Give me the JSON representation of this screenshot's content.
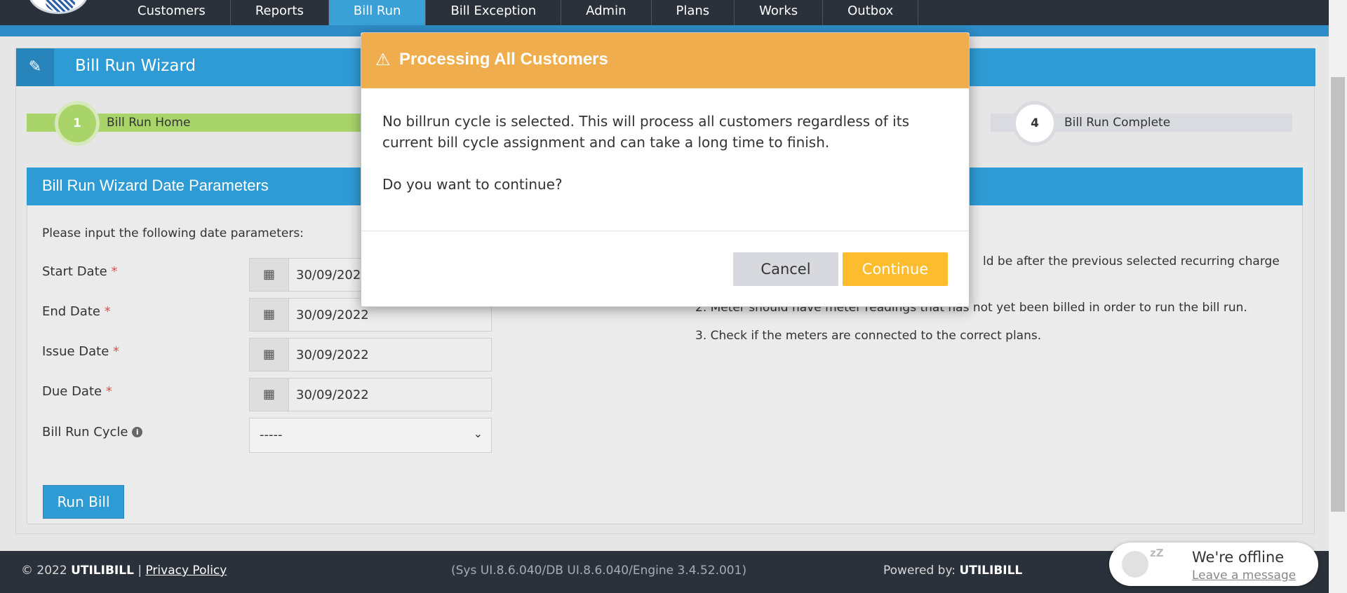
{
  "nav": {
    "tabs": [
      "Customers",
      "Reports",
      "Bill Run",
      "Bill Exception",
      "Admin",
      "Plans",
      "Works",
      "Outbox"
    ],
    "active": "Bill Run"
  },
  "panel": {
    "title": "Bill Run Wizard"
  },
  "steps": [
    {
      "number": "1",
      "label": "Bill Run Home"
    },
    {
      "number": "4",
      "label": "Bill Run Complete"
    }
  ],
  "params": {
    "header": "Bill Run Wizard Date Parameters",
    "intro": "Please input the following date parameters:",
    "required_mark": "*",
    "start_date": {
      "label": "Start Date",
      "value": "30/09/2022"
    },
    "end_date": {
      "label": "End Date",
      "value": "30/09/2022"
    },
    "issue_date": {
      "label": "Issue Date",
      "value": "30/09/2022"
    },
    "due_date": {
      "label": "Due Date",
      "value": "30/09/2022"
    },
    "cycle": {
      "label": "Bill Run Cycle",
      "value": "-----"
    },
    "run_button": "Run Bill"
  },
  "notes": {
    "note1_fragment": "ld be after the previous selected recurring charge",
    "note2": "2. Meter should have meter readings that has not yet been billed in order to run the bill run.",
    "note3": "3. Check if the meters are connected to the correct plans."
  },
  "modal": {
    "title": "Processing All Customers",
    "message_line1": "No billrun cycle is selected. This will process all customers regardless of its",
    "message_line2": "current bill cycle assignment and can take a long time to finish.",
    "question": "Do you want to continue?",
    "cancel": "Cancel",
    "continue": "Continue"
  },
  "footer": {
    "copyright": "© 2022",
    "brand": "UTILIBILL",
    "separator": "|",
    "privacy": "Privacy Policy",
    "version": "(Sys UI.8.6.040/DB UI.8.6.040/Engine 3.4.52.001)",
    "powered_label": "Powered by:",
    "powered_brand": "UTILIBILL"
  },
  "chat": {
    "status": "We're offline",
    "link": "Leave a message"
  },
  "colors": {
    "primary": "#2f9bd5",
    "warning": "#f0ad4e",
    "continue": "#fbbc2e",
    "step_active": "#a9d46a",
    "navbar": "#2b313a"
  }
}
